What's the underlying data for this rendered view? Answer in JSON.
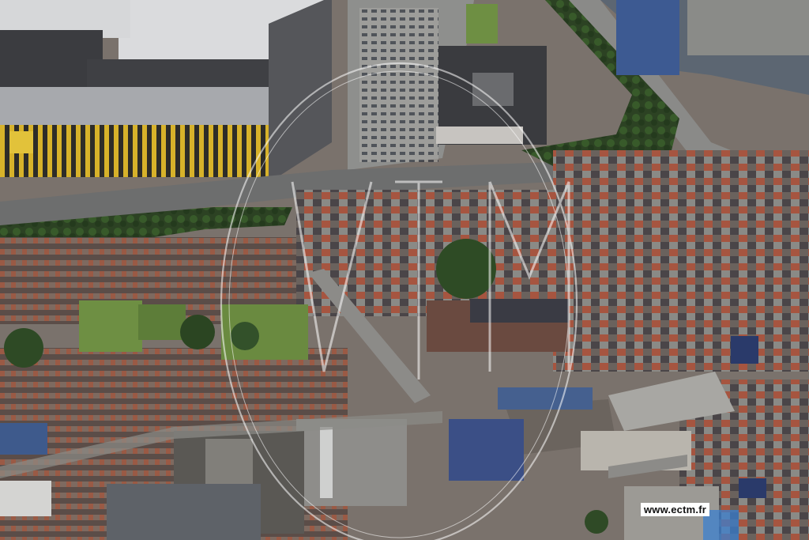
{
  "image": {
    "subject": "aerial-photo",
    "watermark_text": "www.ectm.fr",
    "colors": {
      "roof_dark": "#3c3d41",
      "roof_light": "#d9dadc",
      "brick": "#8a4a3a",
      "tile_red": "#b4573c",
      "vegetation": "#2f4a26",
      "lawn": "#6e8f43",
      "asphalt": "#8f8f8c",
      "hazard_yellow": "#d7b22a"
    }
  }
}
